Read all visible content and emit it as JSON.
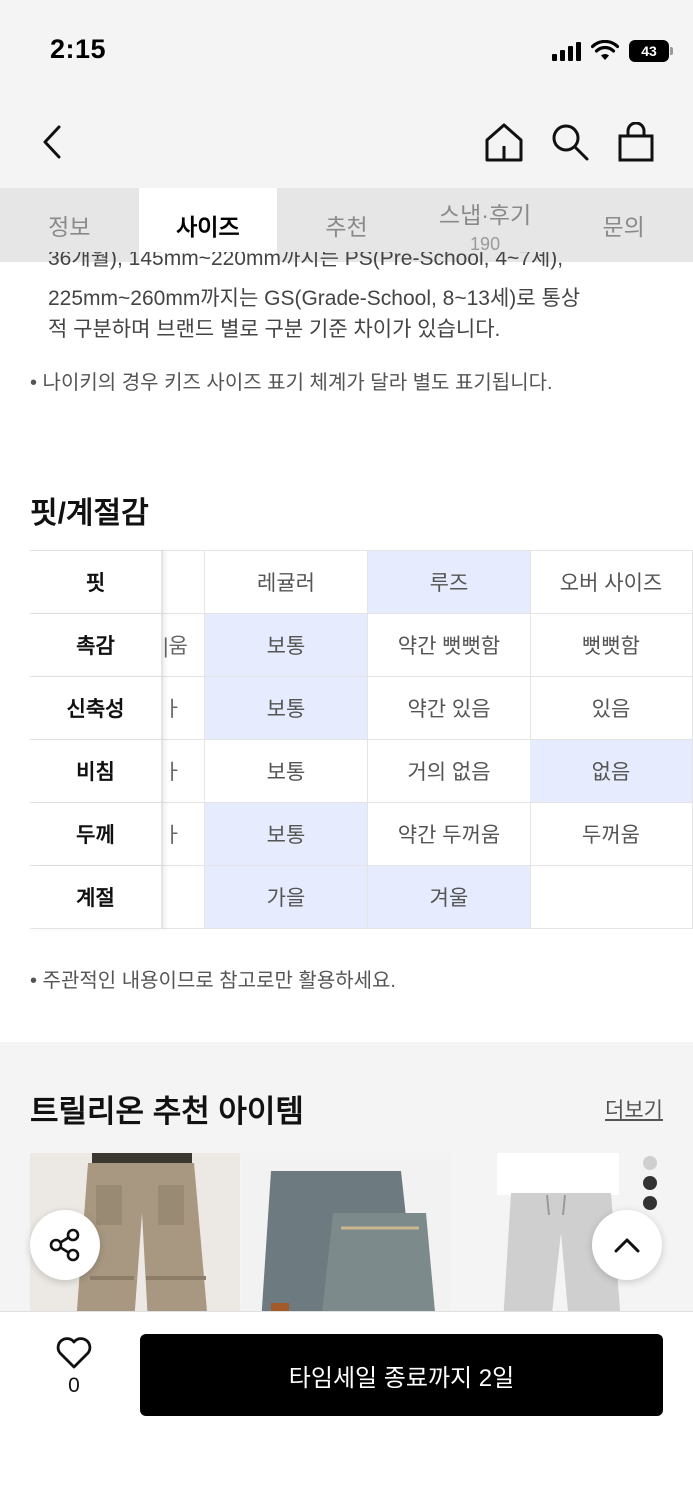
{
  "status_bar": {
    "time": "2:15",
    "battery": "43"
  },
  "header": {
    "back_icon": "chevron-left-icon",
    "home_icon": "home-icon",
    "search_icon": "search-icon",
    "bag_icon": "shopping-bag-icon"
  },
  "tabs": [
    {
      "label": "정보"
    },
    {
      "label": "사이즈",
      "active": true
    },
    {
      "label": "추천"
    },
    {
      "label": "스냅·후기",
      "count": "190"
    },
    {
      "label": "문의"
    }
  ],
  "size_info": {
    "line1": "36개월), 145mm~220mm까지는 PS(Pre-School, 4~7세),",
    "line2": "225mm~260mm까지는 GS(Grade-School, 8~13세)로 통상",
    "line3": "적 구분하며 브랜드 별로 구분 기준 차이가 있습니다.",
    "note": "• 나이키의 경우 키즈 사이즈 표기 체계가 달라 별도 표기됩니다."
  },
  "fit_section": {
    "title": "핏/계절감",
    "rows": [
      {
        "label": "핏",
        "partial": "",
        "cells": [
          "레귤러",
          "루즈",
          "오버 사이즈"
        ],
        "highlight": [
          false,
          true,
          false
        ]
      },
      {
        "label": "촉감",
        "partial": "|움",
        "cells": [
          "보통",
          "약간 뻣뻣함",
          "뻣뻣함"
        ],
        "highlight": [
          true,
          false,
          false
        ]
      },
      {
        "label": "신축성",
        "partial": "ㅏ",
        "cells": [
          "보통",
          "약간 있음",
          "있음"
        ],
        "highlight": [
          true,
          false,
          false
        ]
      },
      {
        "label": "비침",
        "partial": "ㅏ",
        "cells": [
          "보통",
          "거의 없음",
          "없음"
        ],
        "highlight": [
          false,
          false,
          true
        ]
      },
      {
        "label": "두께",
        "partial": "ㅏ",
        "cells": [
          "보통",
          "약간 두꺼움",
          "두꺼움"
        ],
        "highlight": [
          true,
          false,
          false
        ]
      },
      {
        "label": "계절",
        "partial": "",
        "cells": [
          "가을",
          "겨울",
          ""
        ],
        "highlight": [
          true,
          true,
          false
        ]
      }
    ],
    "note": "• 주관적인 내용이므로 참고로만 활용하세요."
  },
  "recommend": {
    "title": "트릴리온 추천 아이템",
    "more_label": "더보기",
    "share_icon": "share-icon",
    "scroll_top_icon": "chevron-up-icon"
  },
  "bottom_bar": {
    "like_icon": "heart-icon",
    "like_count": "0",
    "cta_label": "타임세일 종료까지 2일"
  },
  "colors": {
    "highlight": "#e6ecfd",
    "cta_background": "#000000",
    "header_background": "#f4f4f4",
    "tab_background": "#e6e6e6"
  }
}
